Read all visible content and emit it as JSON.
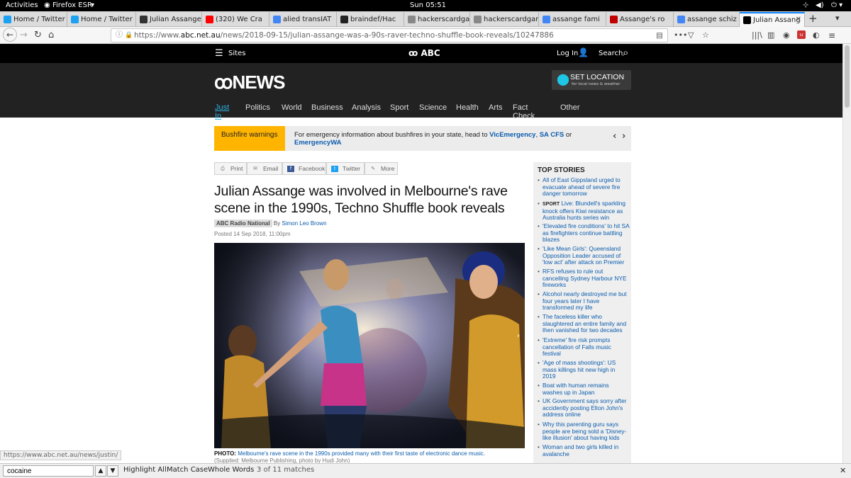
{
  "system_bar": {
    "activities": "Activities",
    "app": "Firefox ESR",
    "clock": "Sun 05:51"
  },
  "tabs": [
    {
      "label": "Home / Twitter",
      "icon": "twitter-icon",
      "color": "#1da1f2"
    },
    {
      "label": "Home / Twitter",
      "icon": "twitter-icon",
      "color": "#1da1f2"
    },
    {
      "label": "Julian Assange",
      "icon": "wikipedia-icon",
      "color": "#333333"
    },
    {
      "label": "(320) We Cra",
      "icon": "youtube-icon",
      "color": "#ff0000"
    },
    {
      "label": "alied transIAT",
      "icon": "google-icon",
      "color": "#4285f4"
    },
    {
      "label": "braindef/Hac",
      "icon": "github-icon",
      "color": "#222222"
    },
    {
      "label": "hackerscardgam",
      "icon": "page-icon",
      "color": "#888888"
    },
    {
      "label": "hackerscardgam",
      "icon": "page-icon",
      "color": "#888888"
    },
    {
      "label": "assange fami",
      "icon": "google-icon",
      "color": "#4285f4"
    },
    {
      "label": "Assange's ro",
      "icon": "news-icon",
      "color": "#c00000"
    },
    {
      "label": "assange schiz",
      "icon": "google-icon",
      "color": "#4285f4"
    },
    {
      "label": "Julian Assang",
      "icon": "abc-icon",
      "color": "#000000"
    }
  ],
  "new_tab": "+",
  "url": {
    "prefix": "https://www.",
    "domain": "abc.net.au",
    "path": "/news/2018-09-15/julian-assange-was-a-90s-raver-techno-shuffle-book-reveals/10247886"
  },
  "abc_bar": {
    "sites": "Sites",
    "brand": "ABC",
    "login": "Log In",
    "search": "Search"
  },
  "news": {
    "logo": "NEWS",
    "set_location": "SET LOCATION",
    "set_location_sub": "for local news & weather",
    "menu": [
      "Just In",
      "Politics",
      "World",
      "Business",
      "Analysis",
      "Sport",
      "Science",
      "Health",
      "Arts",
      "Fact Check",
      "Other"
    ]
  },
  "alert": {
    "label": "Bushfire warnings",
    "text": "For emergency information about bushfires in your state, head to",
    "link1": "VicEmergency",
    "sep": ",",
    "link2": "SA CFS",
    "or": "or",
    "link3": "EmergencyWA"
  },
  "share": [
    "Print",
    "Email",
    "Facebook",
    "Twitter",
    "More"
  ],
  "article": {
    "headline": "Julian Assange was involved in Melbourne's rave scene in the 1990s, Techno Shuffle book reveals",
    "program": "ABC Radio National",
    "by": "By",
    "author": "Simon Leo Brown",
    "posted": "Posted 14 Sep 2018, 11:00pm",
    "photo_label": "PHOTO:",
    "caption": "Melbourne's rave scene in the 1990s provided many with their first taste of electronic dance music.",
    "credit": "(Supplied: Melbourne Publishing, photo by Hudi John)"
  },
  "top_stories": {
    "heading": "TOP STORIES",
    "items": [
      {
        "tag": "",
        "text": "All of East Gippsland urged to evacuate ahead of severe fire danger tomorrow"
      },
      {
        "tag": "SPORT",
        "text": "Live: Blundell's sparkling knock offers Kiwi resistance as Australia hunts series win"
      },
      {
        "tag": "",
        "text": "'Elevated fire conditions' to hit SA as firefighters continue battling blazes"
      },
      {
        "tag": "",
        "text": "'Like Mean Girls': Queensland Opposition Leader accused of 'low act' after attack on Premier"
      },
      {
        "tag": "",
        "text": "RFS refuses to rule out cancelling Sydney Harbour NYE fireworks"
      },
      {
        "tag": "",
        "text": "Alcohol nearly destroyed me but four years later I have transformed my life"
      },
      {
        "tag": "",
        "text": "The faceless killer who slaughtered an entire family and then vanished for two decades"
      },
      {
        "tag": "",
        "text": "'Extreme' fire risk prompts cancellation of Falls music festival"
      },
      {
        "tag": "",
        "text": "'Age of mass shootings': US mass killings hit new high in 2019"
      },
      {
        "tag": "",
        "text": "Boat with human remains washes up in Japan"
      },
      {
        "tag": "",
        "text": "UK Government says sorry after accidently posting Elton John's address online"
      },
      {
        "tag": "",
        "text": "Why this parenting guru says people are being sold a 'Disney-like illusion' about having kids"
      },
      {
        "tag": "",
        "text": "Woman and two girls killed in avalanche"
      }
    ]
  },
  "status_url": "https://www.abc.net.au/news/justin/",
  "findbar": {
    "query": "cocaine",
    "highlight": "Highlight All",
    "match_case": "Match Case",
    "whole_words": "Whole Words",
    "result": "3 of 11 matches"
  }
}
